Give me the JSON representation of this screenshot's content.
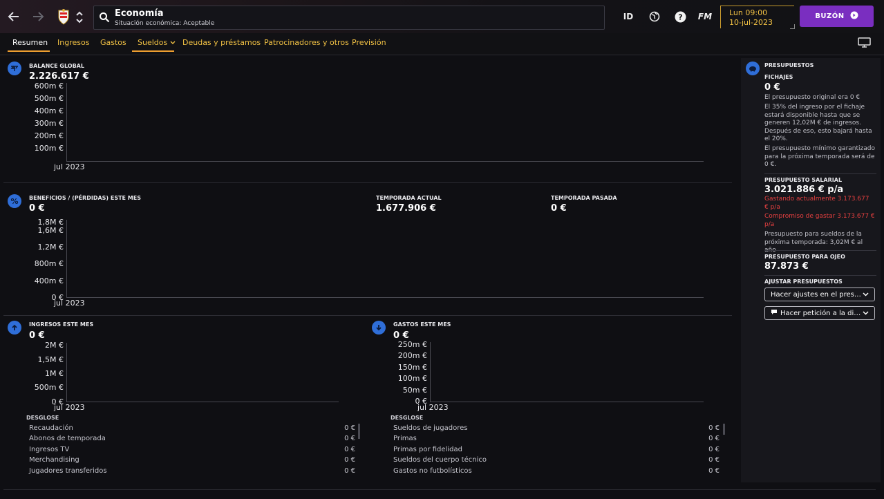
{
  "topbar": {
    "title": "Economía",
    "subtitle": "Situación económica: Aceptable",
    "icons": [
      "back-icon",
      "forward-icon",
      "club-crest-icon",
      "up-down-arrows-icon",
      "search-icon",
      "id-icon",
      "globe-icon",
      "help-icon",
      "fm-logo-icon"
    ],
    "id_label": "ID",
    "fm_label": "FM",
    "clock": {
      "time": "Lun 09:00",
      "date": "10-jul-2023"
    },
    "inbox_label": "BUZÓN"
  },
  "tabs": [
    {
      "label": "Resumen",
      "active": true
    },
    {
      "label": "Ingresos"
    },
    {
      "label": "Gastos"
    },
    {
      "label": "Sueldos",
      "dropdown": true
    },
    {
      "label": "Deudas y préstamos"
    },
    {
      "label": "Patrocinadores y otros"
    },
    {
      "label": "Previsión"
    }
  ],
  "balance": {
    "label": "BALANCE GLOBAL",
    "value": "2.226.617 €",
    "ticks": [
      "600m €",
      "500m €",
      "400m €",
      "300m €",
      "200m €",
      "100m €"
    ],
    "x_label": "jul 2023"
  },
  "profit": {
    "label": "BENEFICIOS / (PÉRDIDAS) ESTE MES",
    "value": "0 €",
    "season_label": "TEMPORADA ACTUAL",
    "season_value": "1.677.906 €",
    "last_label": "TEMPORADA PASADA",
    "last_value": "0 €",
    "ticks": [
      "1,8M €",
      "1,6M €",
      "1,2M €",
      "800m €",
      "400m €",
      "0 €"
    ],
    "x_label": "jul 2023"
  },
  "income": {
    "label": "INGRESOS ESTE MES",
    "value": "0 €",
    "ticks": [
      "2M €",
      "1,5M €",
      "1M €",
      "500m €",
      "0 €"
    ],
    "x_label": "jul 2023",
    "breakdown_label": "DESGLOSE",
    "rows": [
      {
        "name": "Recaudación",
        "value": "0 €"
      },
      {
        "name": "Abonos de temporada",
        "value": "0 €"
      },
      {
        "name": "Ingresos TV",
        "value": "0 €"
      },
      {
        "name": "Merchandising",
        "value": "0 €"
      },
      {
        "name": "Jugadores transferidos",
        "value": "0 €"
      }
    ]
  },
  "expenses": {
    "label": "GASTOS ESTE MES",
    "value": "0 €",
    "ticks": [
      "250m €",
      "200m €",
      "150m €",
      "100m €",
      "50m €",
      "0 €"
    ],
    "x_label": "jul 2023",
    "breakdown_label": "DESGLOSE",
    "rows": [
      {
        "name": "Sueldos de jugadores",
        "value": "0 €"
      },
      {
        "name": "Primas",
        "value": "0 €"
      },
      {
        "name": "Primas por fidelidad",
        "value": "0 €"
      },
      {
        "name": "Sueldos del cuerpo técnico",
        "value": "0 €"
      },
      {
        "name": "Gastos no futbolísticos",
        "value": "0 €"
      }
    ]
  },
  "budgets": {
    "title": "PRESUPUESTOS",
    "transfers_label": "FICHAJES",
    "transfers_value": "0 €",
    "transfers_notes": [
      "El presupuesto original era 0 €",
      "El 35% del ingreso por el fichaje estará disponible hasta que se generen 12,02M € de ingresos. Después de eso, esto bajará hasta el 20%.",
      "El presupuesto mínimo garantizado para la próxima temporada será de 0 €."
    ],
    "wage_label": "PRESUPUESTO SALARIAL",
    "wage_value": "3.021.886 € p/a",
    "wage_spending": "Gastando actualmente 3.173.677 € p/a",
    "wage_committed": "Compromiso de gastar 3.173.677 € p/a",
    "wage_next": "Presupuesto para sueldos de la próxima temporada: 3,02M € al año",
    "scouting_label": "PRESUPUESTO PARA OJEO",
    "scouting_value": "87.873 €",
    "adjust_label": "AJUSTAR PRESUPUESTOS",
    "adjust_btn": "Hacer ajustes en el presupuesto",
    "request_btn": "Hacer petición a la directiva"
  },
  "colors": {
    "accent_blue": "#2f6ed8",
    "tab_gold": "#f0c044",
    "inbox_purple": "#7a2ec0",
    "warning_red": "#e84040"
  }
}
